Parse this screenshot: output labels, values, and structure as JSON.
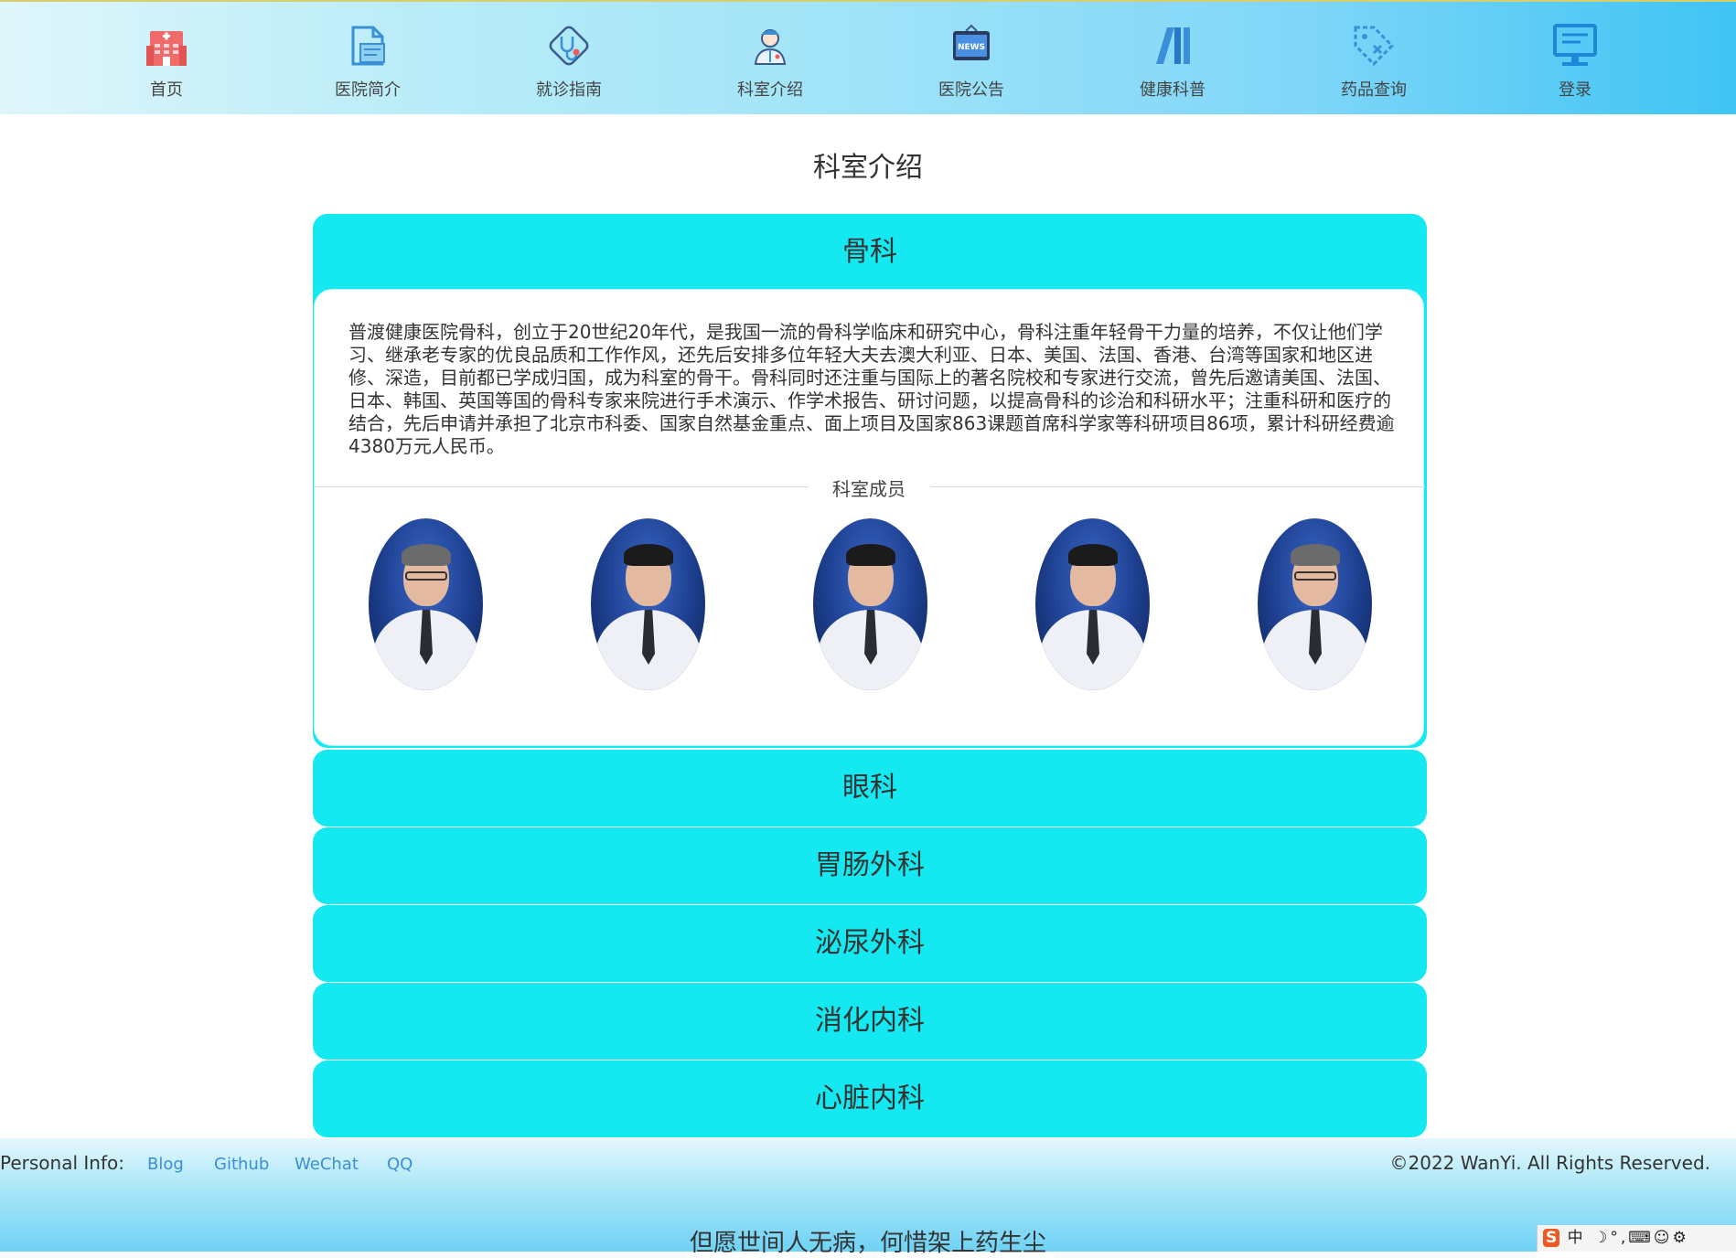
{
  "nav": {
    "items": [
      {
        "label": "首页",
        "icon": "hospital-icon"
      },
      {
        "label": "医院简介",
        "icon": "document-icon"
      },
      {
        "label": "就诊指南",
        "icon": "stethoscope-icon"
      },
      {
        "label": "科室介绍",
        "icon": "doctor-icon"
      },
      {
        "label": "医院公告",
        "icon": "news-icon"
      },
      {
        "label": "健康科普",
        "icon": "books-icon"
      },
      {
        "label": "药品查询",
        "icon": "tag-icon"
      },
      {
        "label": "登录",
        "icon": "monitor-icon"
      }
    ],
    "news_text": "NEWS"
  },
  "page": {
    "title": "科室介绍"
  },
  "departments": [
    {
      "name": "骨科",
      "expanded": true,
      "intro": "普渡健康医院骨科，创立于20世纪20年代，是我国一流的骨科学临床和研究中心，骨科注重年轻骨干力量的培养，不仅让他们学习、继承老专家的优良品质和工作作风，还先后安排多位年轻大夫去澳大利亚、日本、美国、法国、香港、台湾等国家和地区进修、深造，目前都已学成归国，成为科室的骨干。骨科同时还注重与国际上的著名院校和专家进行交流，曾先后邀请美国、法国、日本、韩国、英国等国的骨科专家来院进行手术演示、作学术报告、研讨问题，以提高骨科的诊治和科研水平；注重科研和医疗的结合，先后申请并承担了北京市科委、国家自然基金重点、面上项目及国家863课题首席科学家等科研项目86项，累计科研经费逾4380万元人民币。",
      "members_label": "科室成员",
      "member_count": 5
    },
    {
      "name": "眼科",
      "expanded": false
    },
    {
      "name": "胃肠外科",
      "expanded": false
    },
    {
      "name": "泌尿外科",
      "expanded": false
    },
    {
      "name": "消化内科",
      "expanded": false
    },
    {
      "name": "心脏内科",
      "expanded": false
    }
  ],
  "footer": {
    "personal_label": "Personal Info:",
    "links": [
      "Blog",
      "Github",
      "WeChat",
      "QQ"
    ],
    "copyright": "©2022 WanYi. All Rights Reserved.",
    "motto": "但愿世间人无病，何惜架上药生尘"
  },
  "ime_toolbar": {
    "logo": "S",
    "mode": "中"
  },
  "colors": {
    "accent": "#14e8f0",
    "link": "#3a8fd6",
    "nav_gradient_end": "#3fc4f4"
  }
}
